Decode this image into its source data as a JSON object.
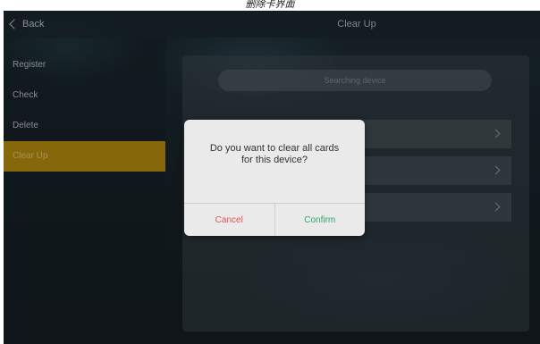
{
  "caption": "删除卡界面",
  "header": {
    "back_label": "Back",
    "title": "Clear Up"
  },
  "sidebar": {
    "items": [
      {
        "label": "Register"
      },
      {
        "label": "Check"
      },
      {
        "label": "Delete"
      },
      {
        "label": "Clear Up",
        "active": true
      }
    ]
  },
  "panel": {
    "search_placeholder": "Searching device"
  },
  "dialog": {
    "message_line1": "Do you want to clear all cards",
    "message_line2": "for this device?",
    "cancel_label": "Cancel",
    "confirm_label": "Confirm"
  },
  "colors": {
    "active_item": "#b38a0c",
    "cancel": "#e0524d",
    "confirm": "#2fa86a"
  }
}
